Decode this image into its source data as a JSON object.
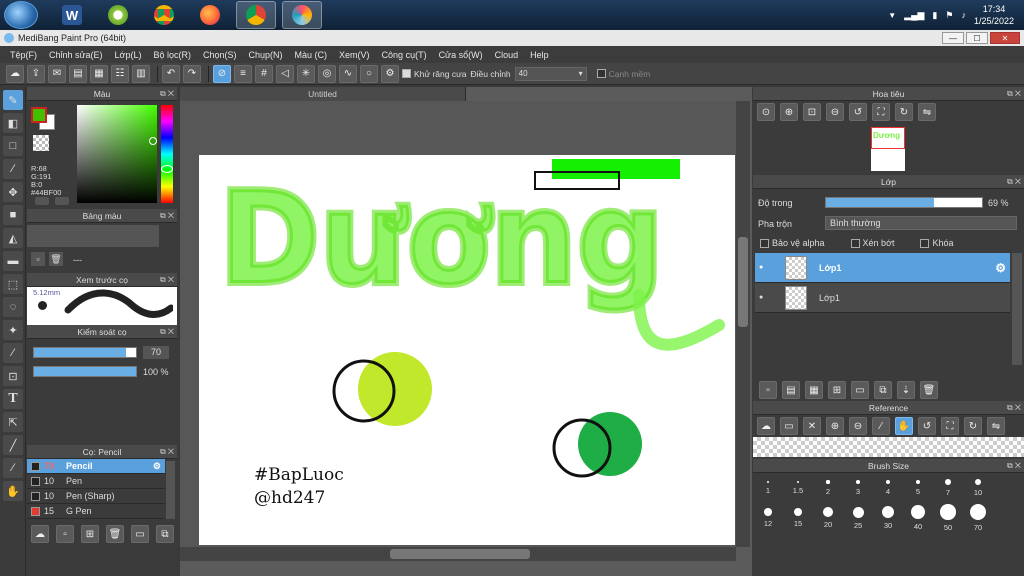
{
  "taskbar": {
    "time": "17:34",
    "date": "1/25/2022",
    "apps": [
      "Microsoft Word",
      "CCleaner",
      "Google Chrome",
      "Firefox",
      "Google Chrome (2)",
      "MediBang Paint Pro"
    ]
  },
  "window": {
    "title": "MediBang Paint Pro (64bit)",
    "minimize": "—",
    "maximize": "☐",
    "close": "✕"
  },
  "menu": [
    "Tệp(F)",
    "Chỉnh sửa(E)",
    "Lớp(L)",
    "Bộ lọc(R)",
    "Chọn(S)",
    "Chụp(N)",
    "Màu (C)",
    "Xem(V)",
    "Công cụ(T)",
    "Cửa sổ(W)",
    "Cloud",
    "Help"
  ],
  "toolbar": {
    "antialias_label": "Khử răng cưa",
    "adjust_label": "Điều chỉnh",
    "adjust_value": "40",
    "edge_label": "Cạnh mềm"
  },
  "color_panel": {
    "title": "Màu",
    "r": "R:68",
    "g": "G:191",
    "b": "B:0",
    "hex": "#44BF00",
    "fg_color": "#44bf00",
    "bg_color": "#ffffff"
  },
  "palette_panel": {
    "title": "Bảng màu",
    "placeholder": "---"
  },
  "brush_preview": {
    "title": "Xem trước cọ",
    "size": "5.12mm"
  },
  "brush_control": {
    "title": "Kiểm soát cọ",
    "size_value": "70",
    "opacity_value": "100 %",
    "size_pct": 0.9,
    "opacity_pct": 1.0
  },
  "brush_list": {
    "title": "Cọ: Pencil",
    "items": [
      {
        "size": "70",
        "name": "Pencil",
        "color": "#222",
        "selected": true
      },
      {
        "size": "10",
        "name": "Pen",
        "color": "#222",
        "selected": false
      },
      {
        "size": "10",
        "name": "Pen (Sharp)",
        "color": "#222",
        "selected": false
      },
      {
        "size": "15",
        "name": "G Pen",
        "color": "#e23b2f",
        "selected": false
      }
    ]
  },
  "document": {
    "tab": "Untitled",
    "text_line1": "#BapLuoc",
    "text_line2": "@hd247",
    "lettering": "Dương"
  },
  "navigator": {
    "title": "Hoa tiêu",
    "thumb_text": "Dương"
  },
  "layer_panel": {
    "title": "Lớp",
    "opacity_label": "Độ trong",
    "opacity_value": "69 %",
    "opacity_pct": 0.69,
    "blend_label": "Pha trộn",
    "blend_value": "Bình thường",
    "protect_alpha": "Bảo vệ alpha",
    "clipping": "Xén bớt",
    "lock": "Khóa",
    "layers": [
      {
        "name": "Lớp1",
        "selected": true
      },
      {
        "name": "Lớp1",
        "selected": false
      }
    ]
  },
  "reference": {
    "title": "Reference"
  },
  "brush_size": {
    "title": "Brush Size",
    "row1": [
      "1",
      "1.5",
      "2",
      "3",
      "4",
      "5",
      "7",
      "10"
    ],
    "row2": [
      "12",
      "15",
      "20",
      "25",
      "30",
      "40",
      "50",
      "70"
    ]
  }
}
